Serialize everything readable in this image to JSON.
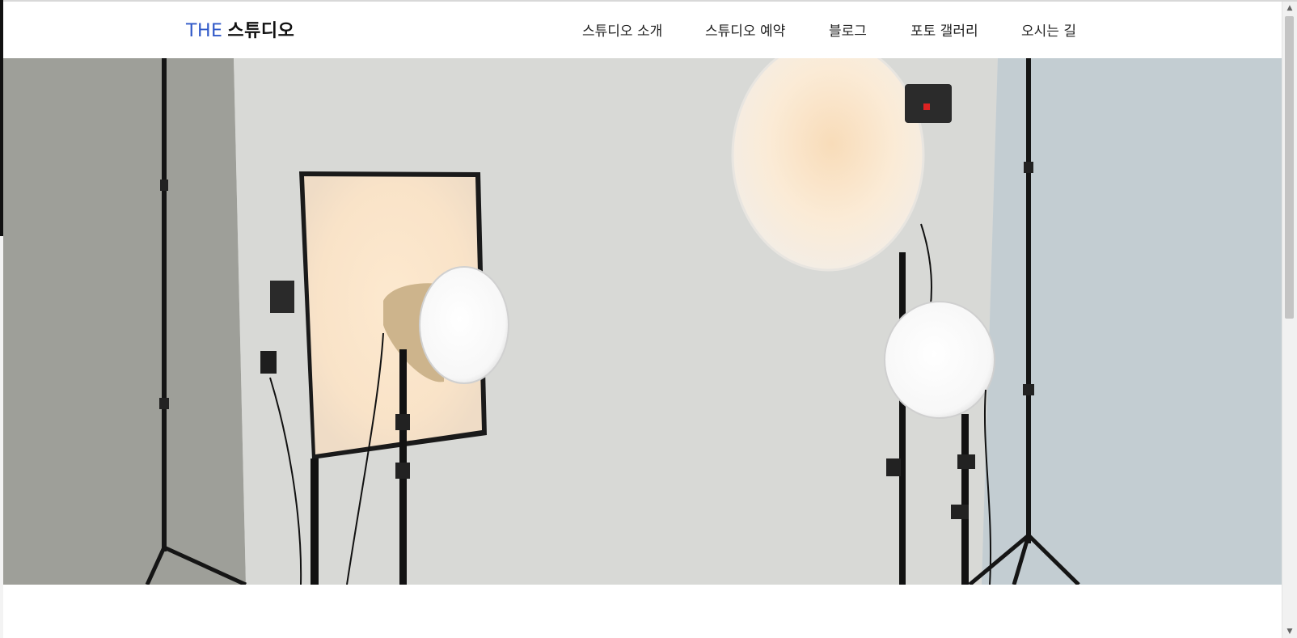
{
  "header": {
    "logo_prefix": "THE",
    "logo_name": "스튜디오"
  },
  "nav": {
    "items": [
      {
        "label": "스튜디오 소개"
      },
      {
        "label": "스튜디오 예약"
      },
      {
        "label": "블로그"
      },
      {
        "label": "포토 갤러리"
      },
      {
        "label": "오시는 길"
      }
    ]
  },
  "colors": {
    "logo_accent": "#2f58c8",
    "text": "#222222",
    "background": "#ffffff"
  },
  "scrollbar": {
    "up_icon": "scroll-up-arrow",
    "down_icon": "scroll-down-arrow"
  }
}
